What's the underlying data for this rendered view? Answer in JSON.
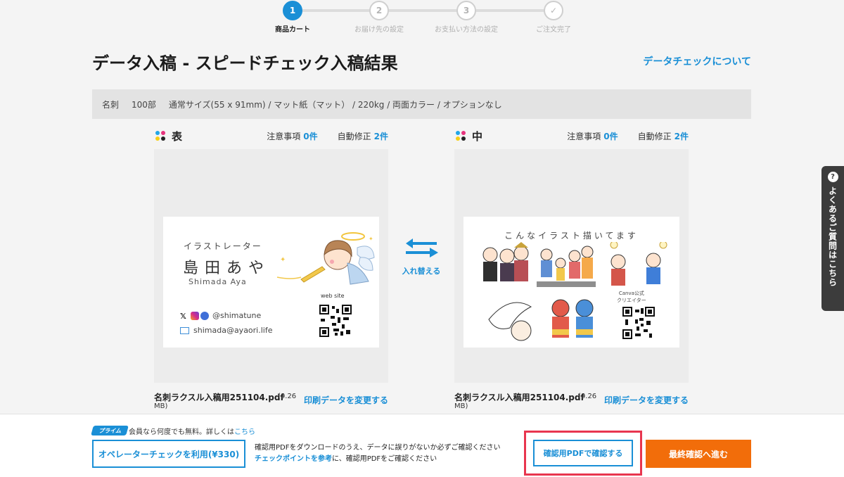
{
  "stepper": {
    "steps": [
      {
        "num": "1",
        "label": "商品カート"
      },
      {
        "num": "2",
        "label": "お届け先の設定"
      },
      {
        "num": "3",
        "label": "お支払い方法の設定"
      },
      {
        "num": "✓",
        "label": "ご注文完了"
      }
    ]
  },
  "header": {
    "title": "データ入稿 - スピードチェック入稿結果",
    "about_link": "データチェックについて"
  },
  "spec": {
    "type": "名刺",
    "quantity": "100部",
    "details": "通常サイズ(55 x 91mm) / マット紙（マット） / 220kg / 両面カラー / オプションなし"
  },
  "front": {
    "side": "表",
    "caution_label": "注意事項",
    "caution_count": "0件",
    "autofix_label": "自動修正",
    "autofix_count": "2件",
    "file_name": "名刺ラクスル入稿用251104.pdf",
    "file_size_a": "(0.26",
    "file_size_b": "MB)",
    "change_link": "印刷データを変更する",
    "card": {
      "role": "イラストレーター",
      "name": "島田あや",
      "roman": "Shimada Aya",
      "sns": "@shimatune",
      "email": "shimada@ayaori.life",
      "web_label": "web site"
    }
  },
  "back": {
    "side": "中",
    "caution_label": "注意事項",
    "caution_count": "0件",
    "autofix_label": "自動修正",
    "autofix_count": "2件",
    "file_name": "名刺ラクスル入稿用251104.pdf",
    "file_size_a": "(0.26",
    "file_size_b": "MB)",
    "change_link": "印刷データを変更する",
    "card": {
      "title": "こんなイラスト描いてます",
      "canva_line1": "Canva公式",
      "canva_line2": "クリエイター"
    }
  },
  "swap": {
    "label": "入れ替える"
  },
  "faq": {
    "label": "よくあるご質問はこちら",
    "icon": "?"
  },
  "bottom": {
    "prime_badge": "プライム",
    "prime_note": "会員なら何度でも無料。詳しくは",
    "prime_link": "こちら",
    "operator_button": "オペレーターチェックを利用(¥330)",
    "notice_line1": "確認用PDFをダウンロードのうえ、データに誤りがないか必ずご確認ください",
    "notice_link": "チェックポイントを参考",
    "notice_line2_rest": "に、確認用PDFをご確認ください",
    "confirm_button": "確認用PDFで確認する",
    "final_button": "最終確認へ進む"
  },
  "colors": {
    "accent": "#1a8fd6",
    "highlight": "#e8364f",
    "final": "#f26d0a"
  }
}
